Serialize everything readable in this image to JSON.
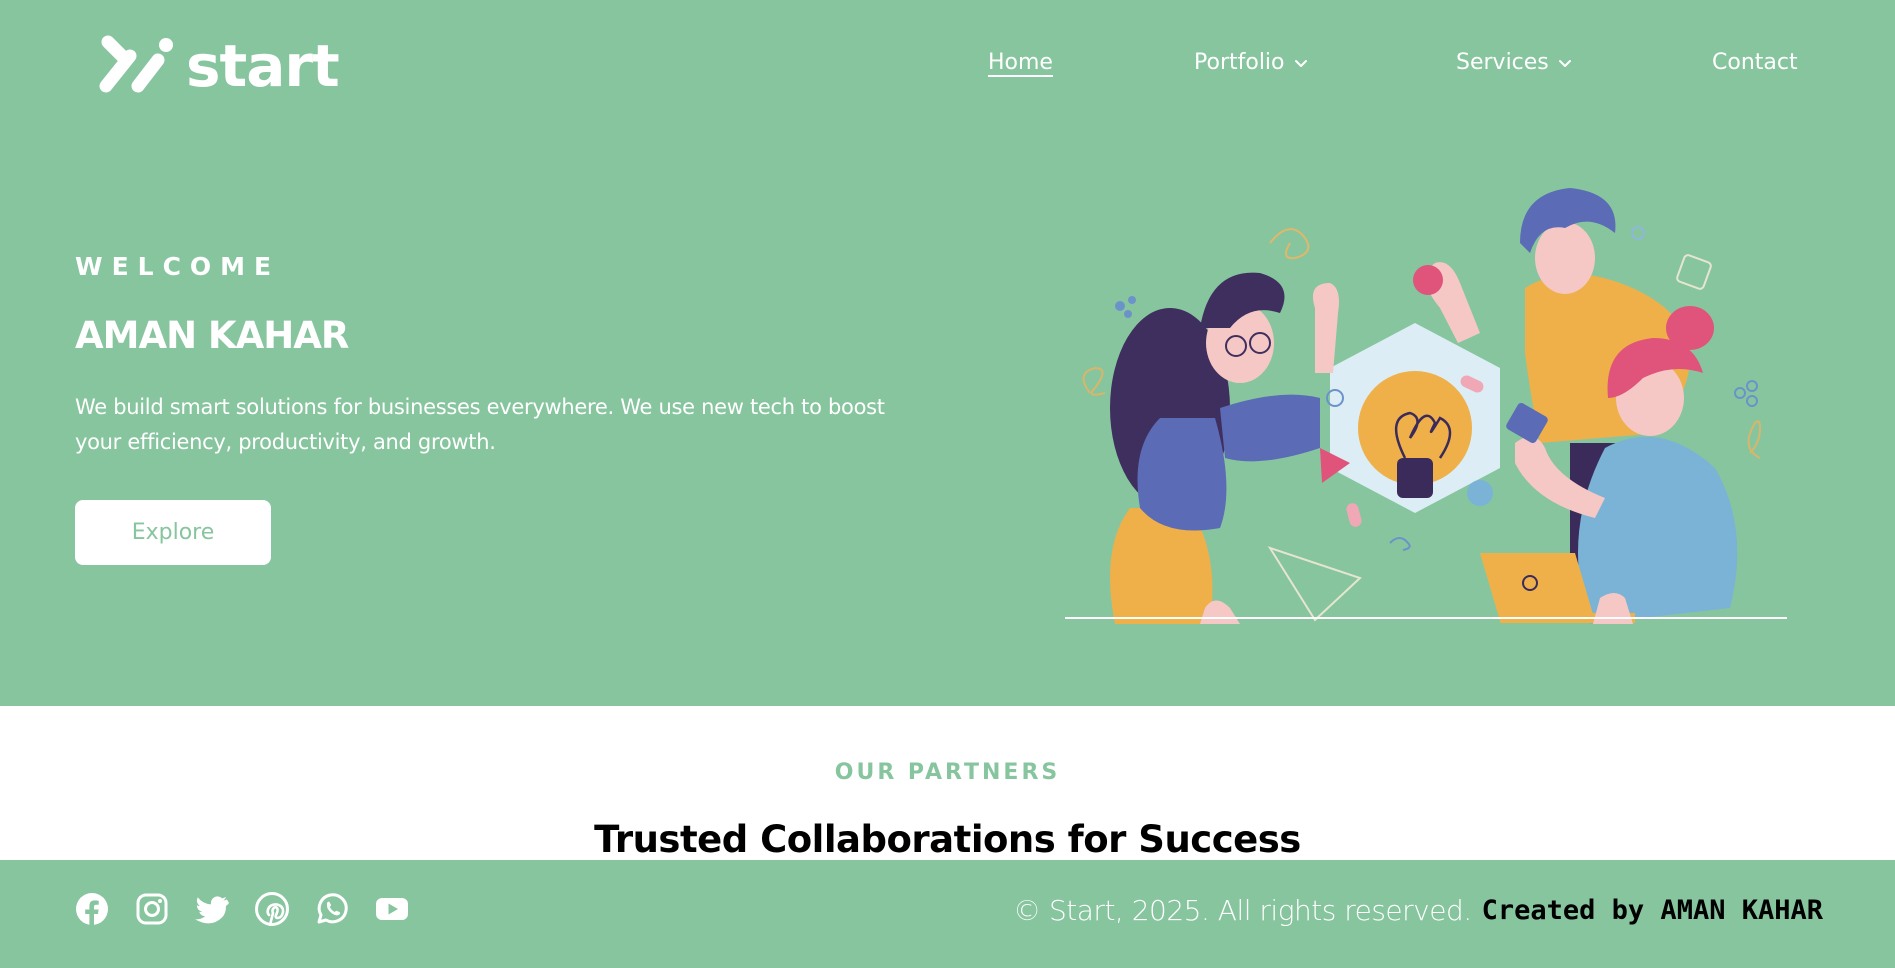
{
  "brand": {
    "name": "start",
    "color": "#87c59f"
  },
  "nav": {
    "items": [
      {
        "label": "Home",
        "active": true
      },
      {
        "label": "Portfolio",
        "dropdown": true
      },
      {
        "label": "Services",
        "dropdown": true
      },
      {
        "label": "Contact"
      }
    ]
  },
  "hero": {
    "eyebrow": "WELCOME",
    "title": "AMAN KAHAR",
    "description": "We build smart solutions for businesses everywhere. We use new tech to boost your efficiency, productivity, and growth.",
    "cta_label": "Explore"
  },
  "partners": {
    "eyebrow": "OUR PARTNERS",
    "title": "Trusted Collaborations for Success"
  },
  "footer": {
    "socials": [
      "facebook-icon",
      "instagram-icon",
      "twitter-icon",
      "pinterest-icon",
      "whatsapp-icon",
      "youtube-icon"
    ],
    "copyright": "© Start, 2025. All rights reserved.",
    "credit": "Created by AMAN KAHAR"
  }
}
